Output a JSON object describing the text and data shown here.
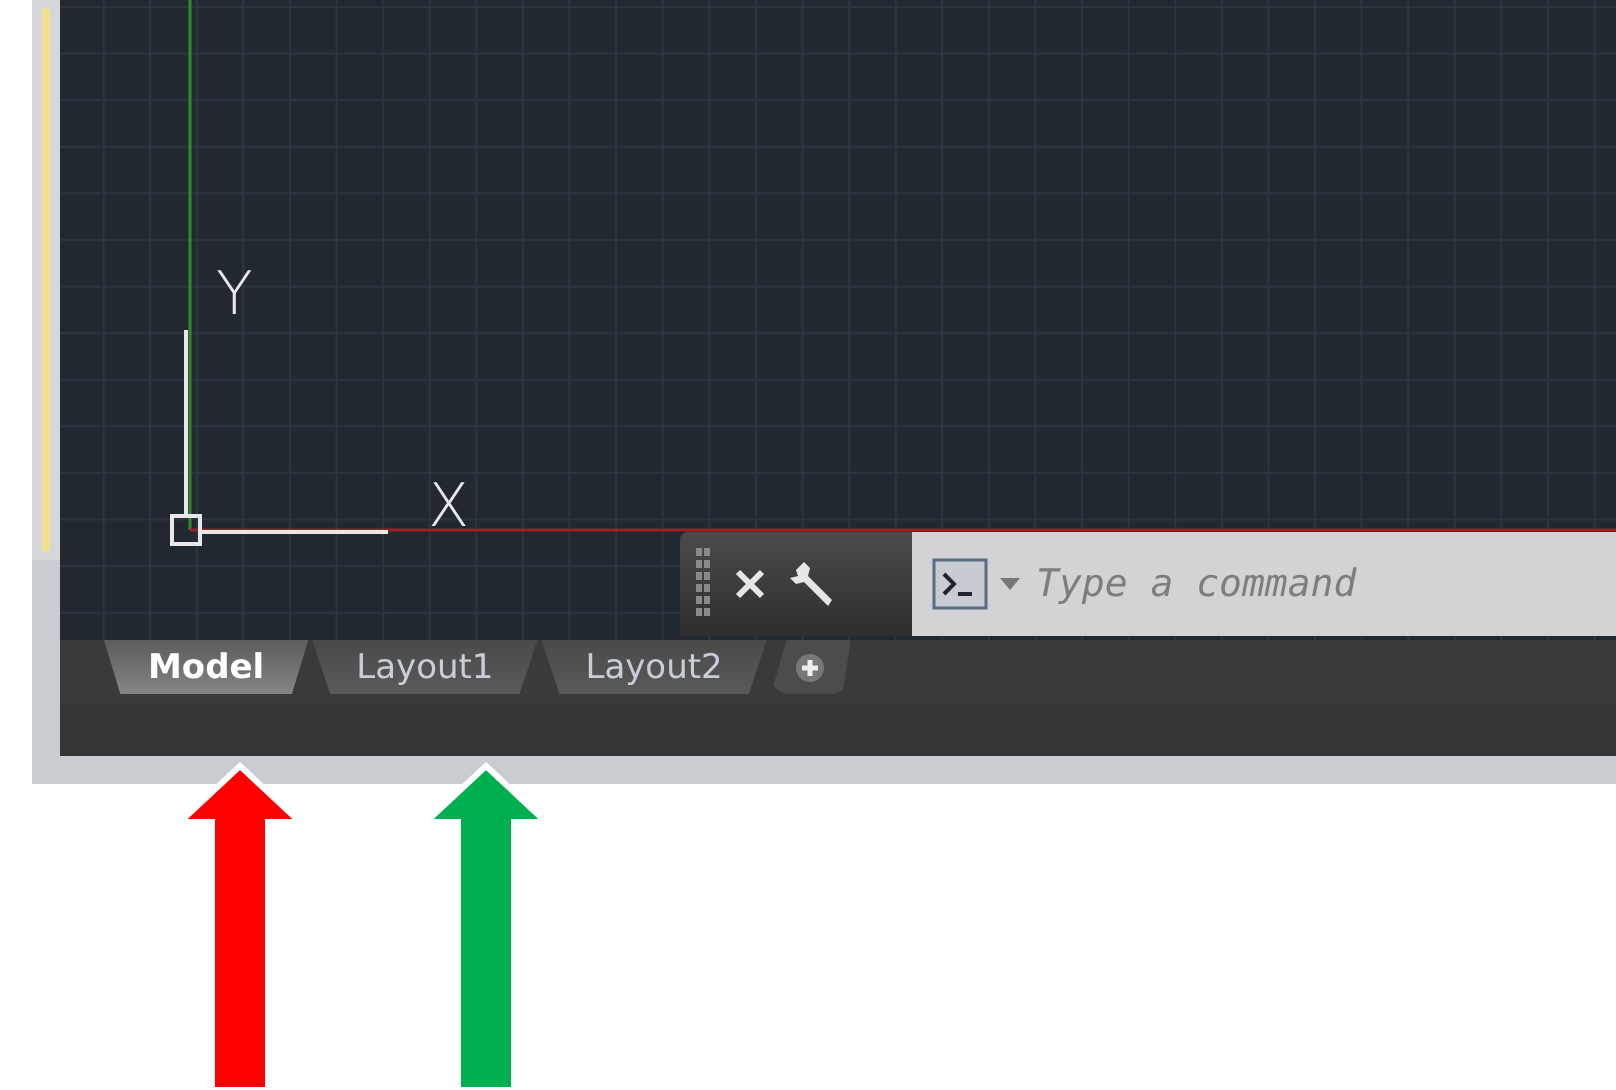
{
  "viewport": {
    "axis_labels": [
      {
        "kind": "y",
        "text": "Y"
      },
      {
        "kind": "x",
        "text": "X"
      }
    ]
  },
  "command_line": {
    "placeholder": "Type a command"
  },
  "layout_tabs": [
    {
      "label": "Model",
      "selected": true
    },
    {
      "label": "Layout1",
      "selected": false
    },
    {
      "label": "Layout2",
      "selected": false
    }
  ],
  "annotation_arrows": [
    {
      "color": "#ff0000"
    },
    {
      "color": "#00b050"
    }
  ]
}
